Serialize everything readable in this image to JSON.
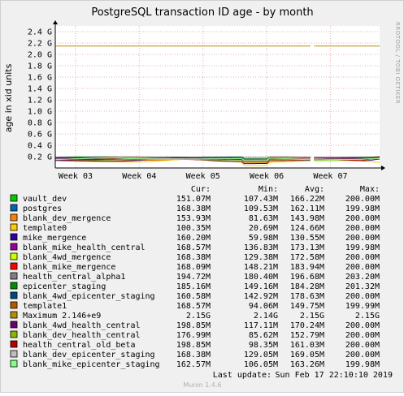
{
  "chart_data": {
    "type": "line",
    "title": "PostgreSQL transaction ID age - by month",
    "ylabel": "age in xid units",
    "side_label": "RRDTOOL / TOBI OETIKER",
    "footer": "Munin 1.4.6",
    "last_update_label": "Last update:",
    "last_update": "Sun Feb 17 22:10:10 2019",
    "x_ticks": [
      "Week 03",
      "Week 04",
      "Week 05",
      "Week 06",
      "Week 07"
    ],
    "y_ticks": [
      "0.2 G",
      "0.4 G",
      "0.6 G",
      "0.8 G",
      "1.0 G",
      "1.2 G",
      "1.4 G",
      "1.6 G",
      "1.8 G",
      "2.0 G",
      "2.2 G",
      "2.4 G"
    ],
    "y_tick_values": [
      0.2,
      0.4,
      0.6,
      0.8,
      1.0,
      1.2,
      1.4,
      1.6,
      1.8,
      2.0,
      2.2,
      2.4
    ],
    "ylim": [
      0,
      2.5
    ],
    "xlim": [
      0,
      1
    ],
    "x_tick_positions": [
      0.0625,
      0.2589,
      0.4554,
      0.6518,
      0.8482
    ],
    "gap": [
      0.787,
      0.798
    ],
    "grid": true,
    "column_headers": [
      "Cur:",
      "Min:",
      "Avg:",
      "Max:"
    ],
    "series": [
      {
        "name": "vault_dev",
        "color": "#00cc00",
        "cur": "151.07M",
        "min": "107.43M",
        "avg": "166.22M",
        "max": "200.00M",
        "curve": [
          0.151,
          0.107,
          0.2,
          0.166
        ]
      },
      {
        "name": "postgres",
        "color": "#0066b3",
        "cur": "168.38M",
        "min": "109.53M",
        "avg": "162.11M",
        "max": "199.98M",
        "curve": [
          0.168,
          0.11,
          0.2,
          0.162
        ]
      },
      {
        "name": "blank_dev_mergence",
        "color": "#ff8000",
        "cur": "153.93M",
        "min": "81.63M",
        "avg": "143.98M",
        "max": "200.00M",
        "curve": [
          0.154,
          0.082,
          0.2,
          0.144
        ]
      },
      {
        "name": "template0",
        "color": "#ffcc00",
        "cur": "100.35M",
        "min": "20.69M",
        "avg": "124.66M",
        "max": "200.00M",
        "curve": [
          0.1,
          0.021,
          0.2,
          0.125
        ]
      },
      {
        "name": "mike_mergence",
        "color": "#330099",
        "cur": "160.20M",
        "min": "59.98M",
        "avg": "130.55M",
        "max": "200.00M",
        "curve": [
          0.16,
          0.06,
          0.2,
          0.131
        ]
      },
      {
        "name": "blank_mike_health_central",
        "color": "#990099",
        "cur": "168.57M",
        "min": "136.83M",
        "avg": "173.13M",
        "max": "199.98M",
        "curve": [
          0.169,
          0.137,
          0.2,
          0.173
        ]
      },
      {
        "name": "blank_4wd_mergence",
        "color": "#ccff00",
        "cur": "168.38M",
        "min": "129.38M",
        "avg": "172.58M",
        "max": "200.00M",
        "curve": [
          0.168,
          0.129,
          0.2,
          0.173
        ]
      },
      {
        "name": "blank_mike_mergence",
        "color": "#ff0000",
        "cur": "168.09M",
        "min": "148.21M",
        "avg": "183.94M",
        "max": "200.00M",
        "curve": [
          0.168,
          0.148,
          0.2,
          0.184
        ]
      },
      {
        "name": "health_central_alpha1",
        "color": "#808080",
        "cur": "194.72M",
        "min": "180.40M",
        "avg": "196.68M",
        "max": "203.20M",
        "curve": [
          0.195,
          0.18,
          0.203,
          0.197
        ]
      },
      {
        "name": "epicenter_staging",
        "color": "#008f00",
        "cur": "185.16M",
        "min": "149.16M",
        "avg": "184.28M",
        "max": "201.32M",
        "curve": [
          0.185,
          0.149,
          0.201,
          0.184
        ]
      },
      {
        "name": "blank_4wd_epicenter_staging",
        "color": "#00487d",
        "cur": "160.58M",
        "min": "142.92M",
        "avg": "178.63M",
        "max": "200.00M",
        "curve": [
          0.161,
          0.143,
          0.2,
          0.179
        ]
      },
      {
        "name": "template1",
        "color": "#b35a00",
        "cur": "168.57M",
        "min": "94.06M",
        "avg": "149.75M",
        "max": "199.99M",
        "curve": [
          0.169,
          0.094,
          0.2,
          0.15
        ]
      },
      {
        "name": "Maximum 2.146+e9",
        "color": "#b38f00",
        "cur": "2.15G",
        "min": "2.14G",
        "avg": "2.15G",
        "max": "2.15G",
        "curve": [
          2.146,
          2.146,
          2.146,
          2.146
        ]
      },
      {
        "name": "blank_4wd_health_central",
        "color": "#6b006b",
        "cur": "198.85M",
        "min": "117.11M",
        "avg": "170.24M",
        "max": "200.00M",
        "curve": [
          0.199,
          0.117,
          0.2,
          0.17
        ]
      },
      {
        "name": "blank_dev_health_central",
        "color": "#8fb300",
        "cur": "176.99M",
        "min": "85.62M",
        "avg": "152.79M",
        "max": "200.00M",
        "curve": [
          0.177,
          0.086,
          0.2,
          0.153
        ]
      },
      {
        "name": "health_central_old_beta",
        "color": "#b30000",
        "cur": "198.85M",
        "min": "98.35M",
        "avg": "161.03M",
        "max": "200.00M",
        "curve": [
          0.199,
          0.098,
          0.2,
          0.161
        ]
      },
      {
        "name": "blank_dev_epicenter_staging",
        "color": "#bebebe",
        "cur": "168.38M",
        "min": "129.05M",
        "avg": "169.05M",
        "max": "200.00M",
        "curve": [
          0.168,
          0.129,
          0.2,
          0.169
        ]
      },
      {
        "name": "blank_mike_epicenter_staging",
        "color": "#80ff80",
        "cur": "162.57M",
        "min": "106.05M",
        "avg": "163.26M",
        "max": "199.98M",
        "curve": [
          0.163,
          0.106,
          0.2,
          0.163
        ]
      }
    ]
  }
}
